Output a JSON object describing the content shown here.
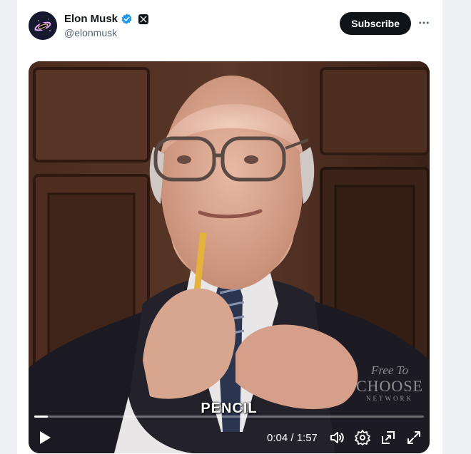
{
  "author": {
    "name": "Elon Musk",
    "handle": "@elonmusk"
  },
  "header": {
    "subscribe_label": "Subscribe"
  },
  "video": {
    "caption": "PENCIL",
    "watermark_line1": "Free To",
    "watermark_line2": "CHOOSE",
    "watermark_line3": "NETWORK",
    "current_time": "0:04",
    "duration": "1:57",
    "time_display": "0:04 / 1:57",
    "progress_fraction": 0.034
  },
  "icons": {
    "avatar": "avatar-image",
    "verified": "verified-badge-icon",
    "affiliate": "x-logo-icon",
    "more": "more-icon",
    "play": "play-icon",
    "volume": "volume-icon",
    "settings": "gear-icon",
    "pip": "picture-in-picture-icon",
    "fullscreen": "fullscreen-icon"
  },
  "colors": {
    "accent_blue": "#1d9bf0",
    "text_primary": "#0f1419",
    "text_secondary": "#536471",
    "button_bg": "#0f1419"
  }
}
